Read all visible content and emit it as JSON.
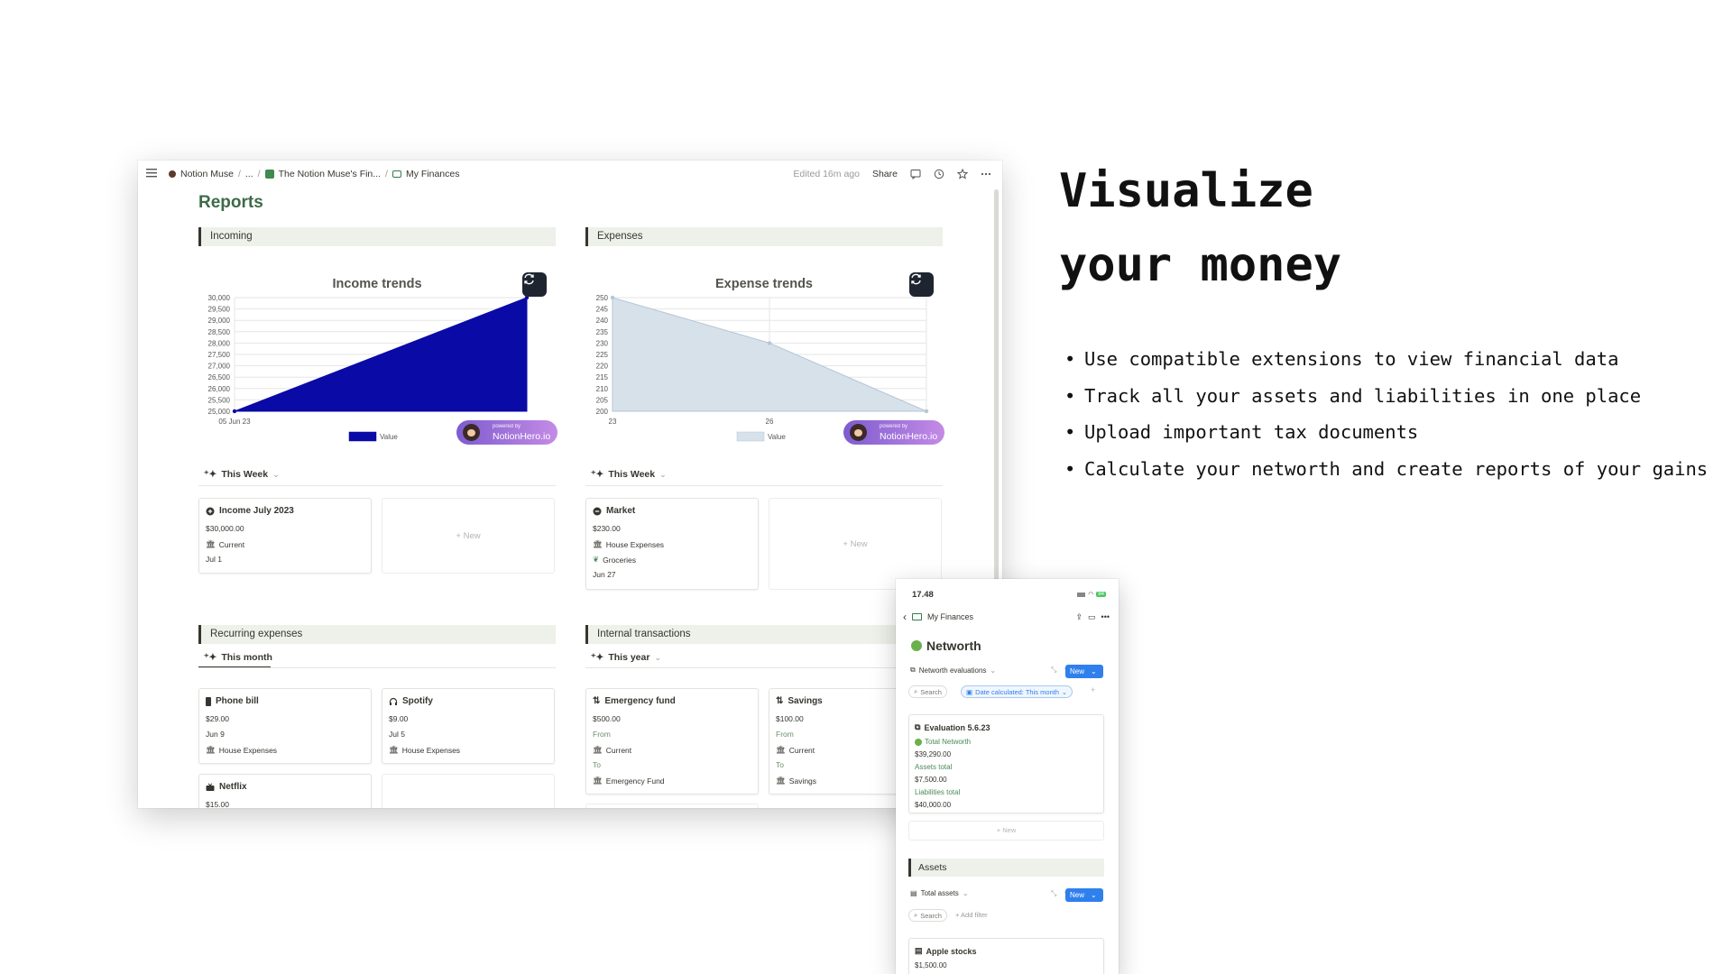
{
  "breadcrumbs": [
    "Notion Muse",
    "...",
    "The Notion Muse's Fin...",
    "My Finances"
  ],
  "topbar": {
    "edited": "Edited 16m ago",
    "share": "Share"
  },
  "page_title": "Reports",
  "sections": {
    "incoming": "Incoming",
    "expenses": "Expenses",
    "recurring": "Recurring expenses",
    "internal": "Internal transactions"
  },
  "income_chart": {
    "title": "Income trends",
    "legend": "Value",
    "y_ticks": [
      "30,000",
      "29,500",
      "29,000",
      "28,500",
      "28,000",
      "27,500",
      "27,000",
      "26,500",
      "26,000",
      "25,500",
      "25,000"
    ],
    "x_ticks": [
      "05 Jun 23"
    ],
    "color": "#0a0aa6"
  },
  "expense_chart": {
    "title": "Expense trends",
    "legend": "Value",
    "y_ticks": [
      "250",
      "245",
      "240",
      "235",
      "230",
      "225",
      "220",
      "215",
      "210",
      "205",
      "200"
    ],
    "x_ticks": [
      "23",
      "26"
    ],
    "color": "#d7e1ea"
  },
  "chart_data": [
    {
      "type": "area",
      "title": "Income trends",
      "series": [
        {
          "name": "Value",
          "values": [
            25000,
            30000
          ]
        }
      ],
      "ylim": [
        25000,
        30000
      ],
      "x_ticks": [
        "05 Jun 23"
      ],
      "grid": true,
      "legend": "bottom"
    },
    {
      "type": "area",
      "title": "Expense trends",
      "series": [
        {
          "name": "Value",
          "values": [
            250,
            230,
            200
          ]
        }
      ],
      "ylim": [
        200,
        250
      ],
      "x_ticks": [
        "23",
        "26"
      ],
      "grid": true,
      "legend": "bottom"
    }
  ],
  "badge": {
    "small": "powered by",
    "big": "NotionHero.io"
  },
  "views": {
    "incoming": "This Week",
    "expenses": "This Week",
    "recurring": "This month",
    "internal": "This year"
  },
  "new_label": "+ New",
  "income_card": {
    "title": "Income July 2023",
    "amount": "$30,000.00",
    "account": "Current",
    "date": "Jul 1"
  },
  "expense_card": {
    "title": "Market",
    "amount": "$230.00",
    "category": "House Expenses",
    "tag": "Groceries",
    "date": "Jun 27"
  },
  "recurring_cards": [
    {
      "title": "Phone bill",
      "amount": "$29.00",
      "date": "Jun 9",
      "category": "House Expenses"
    },
    {
      "title": "Spotify",
      "amount": "$9.00",
      "date": "Jul 5",
      "category": "House Expenses"
    },
    {
      "title": "Netflix",
      "amount": "$15.00"
    }
  ],
  "internal_cards": [
    {
      "title": "Emergency fund",
      "amount": "$500.00",
      "from_label": "From",
      "from": "Current",
      "to_label": "To",
      "to": "Emergency Fund"
    },
    {
      "title": "Savings",
      "amount": "$100.00",
      "from_label": "From",
      "from": "Current",
      "to_label": "To",
      "to": "Savings"
    }
  ],
  "headline": [
    "Visualize",
    "your money"
  ],
  "bullets": [
    "Use compatible extensions to view financial data",
    "Track all your assets and liabilities in one place",
    "Upload important tax documents",
    "Calculate your networth and create reports of your gains"
  ],
  "phone": {
    "time": "17.48",
    "battery": "84",
    "page": "My Finances",
    "heading": "Networth",
    "view1": "Networth evaluations",
    "new": "New",
    "search": "Search",
    "filter1": "Date calculated: This month",
    "eval": {
      "title": "Evaluation 5.6.23",
      "total_label": "Total Networth",
      "total": "$39,290.00",
      "assets_label": "Assets total",
      "assets": "$7,500.00",
      "liab_label": "Liabilities total",
      "liab": "$40,000.00"
    },
    "new_label": "+ New",
    "assets_heading": "Assets",
    "view2": "Total assets",
    "add_filter": "+ Add filter",
    "asset_card": {
      "title": "Apple stocks",
      "amount": "$1,500.00"
    }
  }
}
